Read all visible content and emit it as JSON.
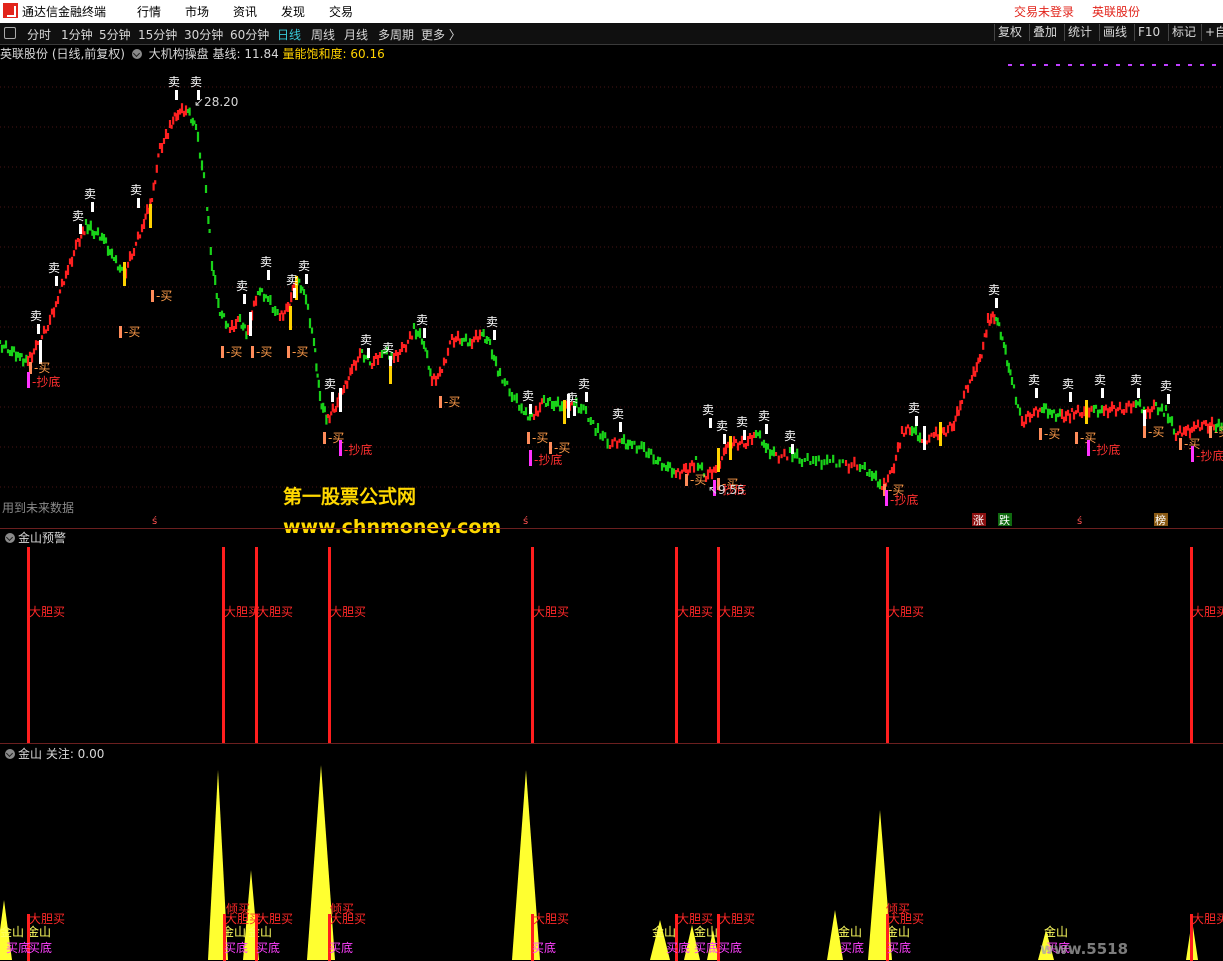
{
  "app": {
    "title": "通达信金融终端",
    "menu": [
      "行情",
      "市场",
      "资讯",
      "发现",
      "交易"
    ],
    "login_status": "交易未登录",
    "stock_name_top": "英联股份"
  },
  "toolbar": {
    "periods": [
      "分时",
      "1分钟",
      "5分钟",
      "15分钟",
      "30分钟",
      "60分钟",
      "日线",
      "周线",
      "月线",
      "多周期",
      "更多 〉"
    ],
    "active_period": "日线",
    "right_buttons": [
      "复权",
      "叠加",
      "统计",
      "画线",
      "F10",
      "标记",
      "+自"
    ]
  },
  "main_chart": {
    "stock_label": "英联股份 (日线,前复权)",
    "indicator_name": "大机构操盘",
    "baseline_label": "基线: 11.84",
    "energy_label": "量能饱和度: 60.16",
    "high_price": "28.20",
    "low_price": "9.55",
    "future_data_note": "用到未来数据",
    "signal_sell": "卖",
    "signal_buy": "买",
    "signal_bottom": "抄底",
    "event_badges": [
      "涨",
      "跌",
      "榜"
    ],
    "colors": {
      "up": "#ff2020",
      "down": "#19d319",
      "flag": "#ffd200",
      "bottom": "#ff33ff"
    }
  },
  "panel2": {
    "title": "金山预警",
    "signal_text": "大胆买"
  },
  "panel3": {
    "title": "金山 关注: 0.00",
    "labels": {
      "jinshan": "金山",
      "bottom": "买底",
      "bold": "大胆买",
      "buy": "倾买"
    }
  },
  "watermark": {
    "line1": "第一股票公式网",
    "line2": "www.chnmoney.com",
    "corner": "www.5518"
  }
}
